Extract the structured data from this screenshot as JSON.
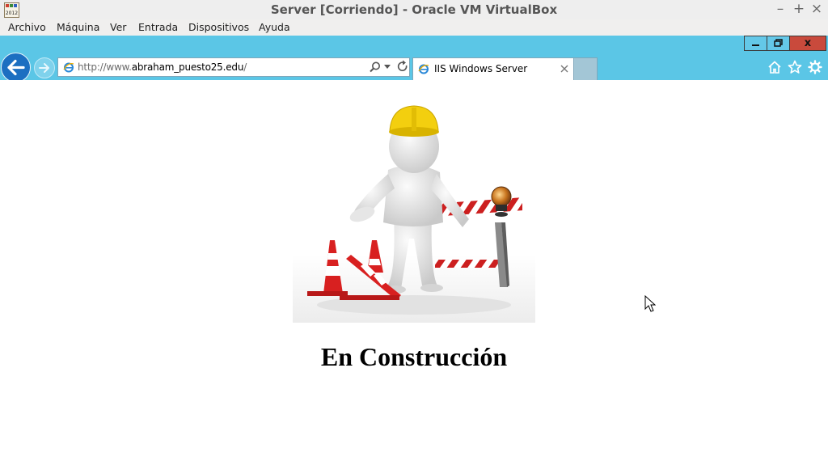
{
  "window": {
    "title": "Server [Corriendo] - Oracle VM VirtualBox",
    "app_icon_text": "2012",
    "controls": {
      "minimize": "–",
      "maximize": "+",
      "close": "×"
    }
  },
  "menubar": {
    "items": [
      "Archivo",
      "Máquina",
      "Ver",
      "Entrada",
      "Dispositivos",
      "Ayuda"
    ]
  },
  "browser": {
    "address": {
      "prefix": "http://www.",
      "domain": "abraham_puesto25.edu",
      "suffix": "/"
    },
    "tabs": [
      {
        "label": "IIS Windows Server",
        "active": true
      }
    ],
    "guest_controls": {
      "close": "x"
    },
    "toolbar_icons": [
      "home-icon",
      "favorites-star-icon",
      "tools-gear-icon"
    ]
  },
  "page": {
    "heading": "En Construcción"
  },
  "colors": {
    "ie_chrome": "#5bc6e6",
    "back_button": "#1c6fc1",
    "guest_close": "#c94a3c"
  }
}
